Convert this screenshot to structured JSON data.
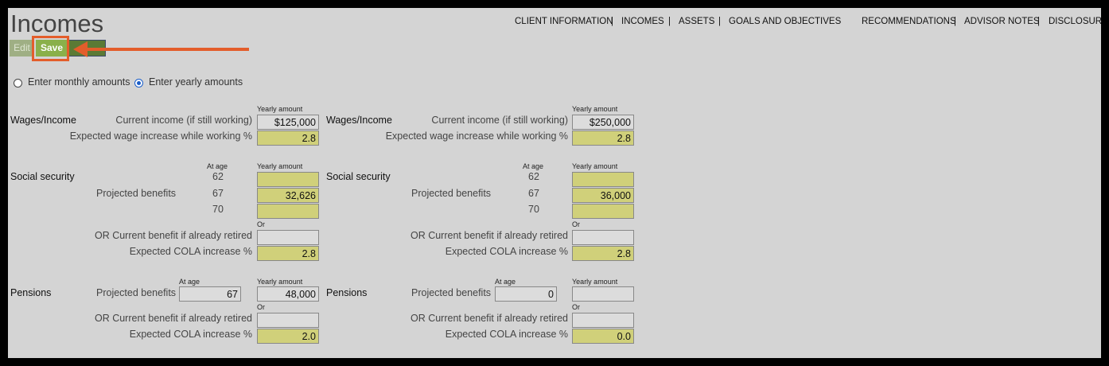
{
  "page_title": "Incomes",
  "nav": [
    "CLIENT INFORMATION",
    "INCOMES",
    "ASSETS",
    "GOALS AND OBJECTIVES",
    "RECOMMENDATIONS",
    "ADVISOR NOTES",
    "DISCLOSURE"
  ],
  "buttons": {
    "edit": "Edit",
    "save": "Save"
  },
  "mode": {
    "monthly_label": "Enter monthly amounts",
    "yearly_label": "Enter yearly amounts",
    "selected": "yearly"
  },
  "labels": {
    "yearly_amount": "Yearly amount",
    "at_age": "At age",
    "or": "Or",
    "wages_section": "Wages/Income",
    "current_income": "Current income (if still working)",
    "wage_increase": "Expected wage increase while working %",
    "ss_section": "Social security",
    "projected_benefits": "Projected benefits",
    "or_current_benefit": "OR Current benefit if already retired",
    "cola": "Expected COLA increase %",
    "pensions_section": "Pensions"
  },
  "ss_ages": [
    "62",
    "67",
    "70"
  ],
  "left": {
    "current_income": "$125,000",
    "wage_increase": "2.8",
    "ss_62": "",
    "ss_67": "32,626",
    "ss_70": "",
    "ss_current": "",
    "ss_cola": "2.8",
    "pension_age": "67",
    "pension_amount": "48,000",
    "pension_current": "",
    "pension_cola": "2.0"
  },
  "right": {
    "current_income": "$250,000",
    "wage_increase": "2.8",
    "ss_62": "",
    "ss_67": "36,000",
    "ss_70": "",
    "ss_current": "",
    "ss_cola": "2.8",
    "pension_age": "0",
    "pension_amount": "",
    "pension_current": "",
    "pension_cola": "0.0"
  }
}
